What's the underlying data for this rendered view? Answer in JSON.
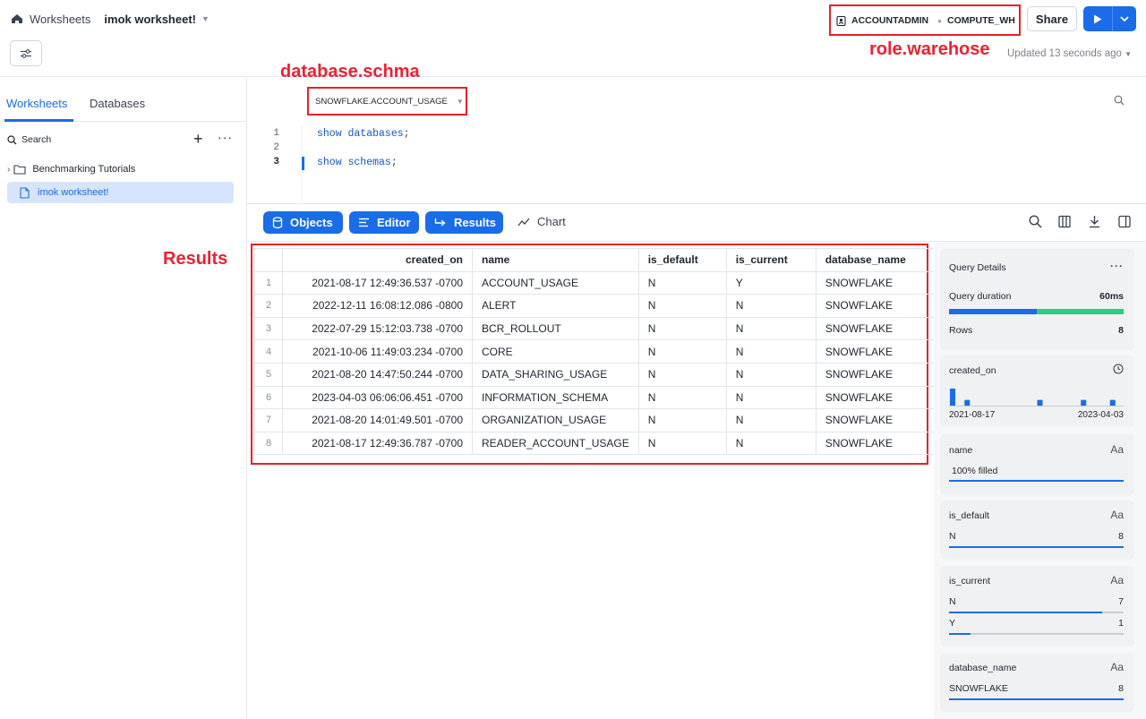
{
  "header": {
    "breadcrumb_root": "Worksheets",
    "worksheet_title": "imok worksheet!",
    "role": "ACCOUNTADMIN",
    "warehouse": "COMPUTE_WH",
    "share_label": "Share",
    "updated_text": "Updated 13 seconds ago"
  },
  "annotations": {
    "role_warehouse": "role.warehose",
    "database_schema": "database.schma",
    "results": "Results"
  },
  "sidebar": {
    "tabs": [
      "Worksheets",
      "Databases"
    ],
    "search_label": "Search",
    "items": [
      {
        "label": "Benchmarking Tutorials",
        "type": "folder"
      },
      {
        "label": "imok worksheet!",
        "type": "worksheet",
        "selected": true
      }
    ]
  },
  "editor": {
    "context": "SNOWFLAKE.ACCOUNT_USAGE",
    "lines": [
      {
        "n": "1",
        "code": "show databases",
        "semi": ";"
      },
      {
        "n": "2",
        "code": "",
        "semi": ""
      },
      {
        "n": "3",
        "code": "show schemas",
        "semi": ";"
      }
    ]
  },
  "results_toolbar": {
    "objects": "Objects",
    "editor": "Editor",
    "results": "Results",
    "chart": "Chart"
  },
  "results": {
    "columns": [
      "created_on",
      "name",
      "is_default",
      "is_current",
      "database_name"
    ],
    "rows": [
      [
        "1",
        "2021-08-17 12:49:36.537 -0700",
        "ACCOUNT_USAGE",
        "N",
        "Y",
        "SNOWFLAKE"
      ],
      [
        "2",
        "2022-12-11 16:08:12.086 -0800",
        "ALERT",
        "N",
        "N",
        "SNOWFLAKE"
      ],
      [
        "3",
        "2022-07-29 15:12:03.738 -0700",
        "BCR_ROLLOUT",
        "N",
        "N",
        "SNOWFLAKE"
      ],
      [
        "4",
        "2021-10-06 11:49:03.234 -0700",
        "CORE",
        "N",
        "N",
        "SNOWFLAKE"
      ],
      [
        "5",
        "2021-08-20 14:47:50.244 -0700",
        "DATA_SHARING_USAGE",
        "N",
        "N",
        "SNOWFLAKE"
      ],
      [
        "6",
        "2023-04-03 06:06:06.451 -0700",
        "INFORMATION_SCHEMA",
        "N",
        "N",
        "SNOWFLAKE"
      ],
      [
        "7",
        "2021-08-20 14:01:49.501 -0700",
        "ORGANIZATION_USAGE",
        "N",
        "N",
        "SNOWFLAKE"
      ],
      [
        "8",
        "2021-08-17 12:49:36.787 -0700",
        "READER_ACCOUNT_USAGE",
        "N",
        "N",
        "SNOWFLAKE"
      ]
    ]
  },
  "query_details": {
    "title": "Query Details",
    "duration_label": "Query duration",
    "duration_value": "60ms",
    "duration_split": [
      0.5,
      0.5
    ],
    "rows_label": "Rows",
    "rows_value": "8"
  },
  "column_stats": {
    "created_on": {
      "label": "created_on",
      "min": "2021-08-17",
      "max": "2023-04-03",
      "histogram": [
        3,
        1,
        0,
        0,
        0,
        0,
        1,
        0,
        0,
        1,
        0,
        1
      ]
    },
    "name": {
      "label": "name",
      "type_icon": "Aa",
      "fill_text": "100% filled",
      "fill": 1.0
    },
    "is_default": {
      "label": "is_default",
      "type_icon": "Aa",
      "values": [
        {
          "v": "N",
          "count": "8",
          "frac": 1.0
        }
      ]
    },
    "is_current": {
      "label": "is_current",
      "type_icon": "Aa",
      "values": [
        {
          "v": "N",
          "count": "7",
          "frac": 0.875
        },
        {
          "v": "Y",
          "count": "1",
          "frac": 0.125
        }
      ]
    },
    "database_name": {
      "label": "database_name",
      "type_icon": "Aa",
      "values": [
        {
          "v": "SNOWFLAKE",
          "count": "8",
          "frac": 1.0
        }
      ]
    }
  },
  "colors": {
    "accent": "#1a6ce8",
    "annotation": "#ee2131",
    "duration_secondary": "#2dcb86"
  }
}
